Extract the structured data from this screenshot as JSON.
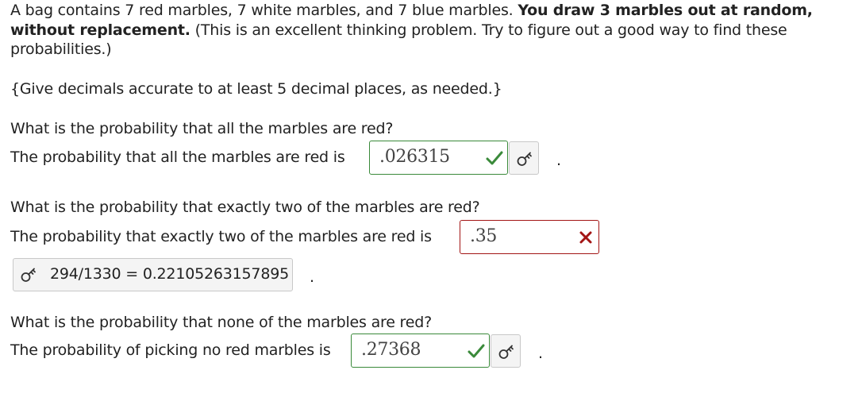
{
  "problem": {
    "intro_plain": "A bag contains 7 red marbles, 7 white marbles, and 7 blue marbles.",
    "intro_bold": "You draw 3 marbles out at random, without replacement.",
    "intro_tail": "(This is an excellent thinking problem. Try to figure out a good way to find these probabilities.)",
    "instructions": "{Give decimals accurate to at least 5 decimal places, as needed.}"
  },
  "q1": {
    "question": "What is the probability that all the marbles are red?",
    "prompt": "The probability that all the marbles are red is",
    "answer": ".026315",
    "status": "correct",
    "period": "."
  },
  "q2": {
    "question": "What is the probability that exactly two of the marbles are red?",
    "prompt": "The probability that exactly two of the marbles are red is",
    "answer": ".35",
    "status": "incorrect",
    "correct_answer": "294/1330 = 0.22105263157895",
    "period": "."
  },
  "q3": {
    "question": "What is the probability that none of the marbles are red?",
    "prompt": "The probability of picking no red marbles is",
    "answer": ".27368",
    "status": "correct",
    "period": "."
  },
  "icons": {
    "correct": "check-icon",
    "incorrect": "x-icon",
    "key": "key-icon"
  },
  "colors": {
    "correct": "#3a8a3a",
    "incorrect": "#a31515",
    "text": "#222222"
  }
}
